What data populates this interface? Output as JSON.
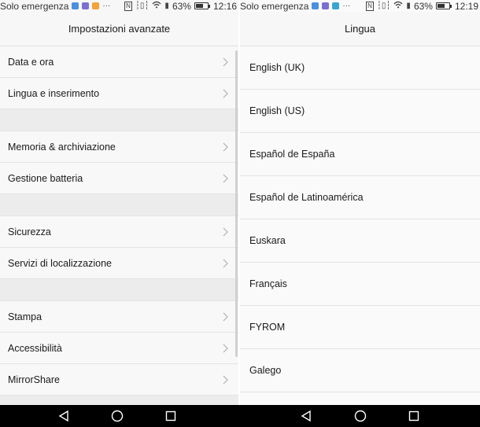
{
  "left": {
    "status": {
      "carrier": "Solo emergenza",
      "battery_percent": "63%",
      "battery_level": 0.63,
      "time": "12:16"
    },
    "title": "Impostazioni avanzate",
    "groups": [
      [
        "Data e ora",
        "Lingua e inserimento"
      ],
      [
        "Memoria & archiviazione",
        "Gestione batteria"
      ],
      [
        "Sicurezza",
        "Servizi di localizzazione"
      ],
      [
        "Stampa",
        "Accessibilità",
        "MirrorShare"
      ]
    ]
  },
  "right": {
    "status": {
      "carrier": "Solo emergenza",
      "battery_percent": "63%",
      "battery_level": 0.63,
      "time": "12:19"
    },
    "title": "Lingua",
    "languages": [
      "English (UK)",
      "English (US)",
      "Español de España",
      "Español de Latinoamérica",
      "Euskara",
      "Français",
      "FYROM",
      "Galego"
    ]
  },
  "colors": {
    "notif_1": "#4a8fe0",
    "notif_2": "#7a6fd0",
    "notif_3": "#f2a33a",
    "notif_cal": "#3aa6d0"
  },
  "icons": {
    "chevron": "chevron-right-icon",
    "back": "back-icon",
    "home": "home-icon",
    "recents": "recents-icon"
  }
}
